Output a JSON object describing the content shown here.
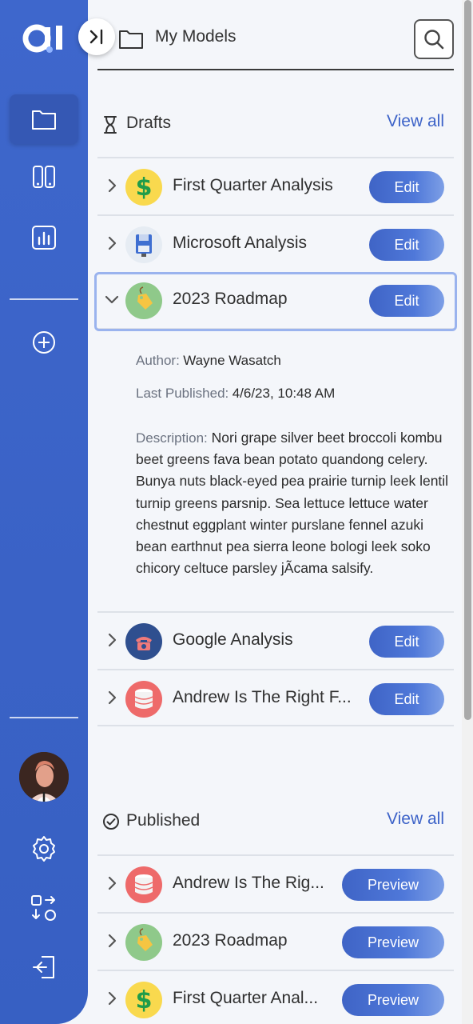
{
  "header": {
    "title": "My Models"
  },
  "sidebar": {
    "items": [
      {
        "name": "folder-icon"
      },
      {
        "name": "compare-icon"
      },
      {
        "name": "chart-icon"
      },
      {
        "name": "add-icon"
      },
      {
        "name": "settings-icon"
      },
      {
        "name": "swap-icon"
      },
      {
        "name": "logout-icon"
      }
    ],
    "accent": "#3e67cc"
  },
  "drafts": {
    "label": "Drafts",
    "view_all": "View all",
    "items": [
      {
        "name": "First Quarter Analysis",
        "action": "Edit",
        "icon": "dollar-icon"
      },
      {
        "name": "Microsoft Analysis",
        "action": "Edit",
        "icon": "floppy-icon"
      },
      {
        "name": "2023 Roadmap",
        "action": "Edit",
        "icon": "tag-icon",
        "expanded": true
      },
      {
        "name": "Google Analysis",
        "action": "Edit",
        "icon": "phone-icon"
      },
      {
        "name": "Andrew Is The Right F...",
        "action": "Edit",
        "icon": "database-icon"
      }
    ]
  },
  "details": {
    "author_label": "Author:",
    "author": "Wayne Wasatch",
    "published_label": "Last Published:",
    "published": "4/6/23, 10:48 AM",
    "description_label": "Description:",
    "description": "Nori grape silver beet broccoli kombu beet greens fava bean potato quandong celery. Bunya nuts black-eyed pea prairie turnip leek lentil turnip greens parsnip. Sea lettuce lettuce water chestnut eggplant winter purslane fennel azuki bean earthnut pea sierra leone bologi leek soko chicory celtuce parsley jÃcama salsify."
  },
  "published": {
    "label": "Published",
    "view_all": "View all",
    "items": [
      {
        "name": "Andrew Is The Rig...",
        "action": "Preview",
        "icon": "database-icon"
      },
      {
        "name": "2023 Roadmap",
        "action": "Preview",
        "icon": "tag-icon"
      },
      {
        "name": "First Quarter Anal...",
        "action": "Preview",
        "icon": "dollar-icon"
      }
    ]
  }
}
